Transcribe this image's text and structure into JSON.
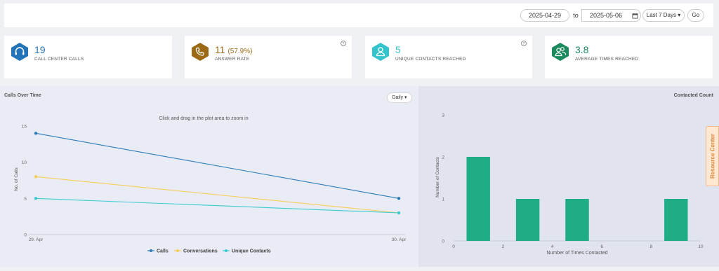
{
  "filters": {
    "date_from": "2025-04-29",
    "to_label": "to",
    "date_to": "2025-05-06",
    "calendar_icon": "calendar-icon",
    "range_label": "Last 7 Days ▾",
    "go_label": "Go"
  },
  "stats": [
    {
      "value": "19",
      "value_extra": "",
      "label": "CALL CENTER CALLS",
      "icon": "headset-icon",
      "color": "#2373b8",
      "value_color": "#2373b8"
    },
    {
      "value": "11",
      "value_extra": "(57.9%)",
      "label": "ANSWER RATE",
      "icon": "phone-icon",
      "color": "#9c6a14",
      "value_color": "#9c6a14"
    },
    {
      "value": "5",
      "value_extra": "",
      "label": "UNIQUE CONTACTS REACHED",
      "icon": "user-icon",
      "color": "#36c4cc",
      "value_color": "#36c4cc"
    },
    {
      "value": "3.8",
      "value_extra": "",
      "label": "AVERAGE TIMES REACHED",
      "icon": "users-icon",
      "color": "#1b8a5e",
      "value_color": "#1b8a5e"
    }
  ],
  "calls_panel": {
    "title": "Calls Over Time",
    "granularity": "Daily ▾"
  },
  "contacted_panel": {
    "title": "Contacted Count"
  },
  "resource_center": "Resource Center",
  "chart_data": [
    {
      "type": "line",
      "subtitle": "Click and drag in the plot area to zoom in",
      "ylabel": "No. of Calls",
      "xlabel": "",
      "categories": [
        "29. Apr",
        "30. Apr"
      ],
      "ylim": [
        0,
        15
      ],
      "yticks": [
        0,
        5,
        10,
        15
      ],
      "grid": false,
      "legend_position": "bottom-center",
      "series": [
        {
          "name": "Calls",
          "values": [
            14,
            5
          ],
          "color": "#2b7bb9"
        },
        {
          "name": "Conversations",
          "values": [
            8,
            3
          ],
          "color": "#f5cd57"
        },
        {
          "name": "Unique Contacts",
          "values": [
            5,
            3
          ],
          "color": "#3ccbd0"
        }
      ]
    },
    {
      "type": "bar",
      "title": "Contacted Count",
      "xlabel": "Number of Times Contacted",
      "ylabel": "Number of Contacts",
      "xlim": [
        0,
        10
      ],
      "xticks": [
        0,
        2,
        4,
        6,
        8,
        10
      ],
      "ylim": [
        0,
        3
      ],
      "yticks": [
        0,
        1,
        2,
        3
      ],
      "bar_color": "#1fad85",
      "bins": [
        {
          "x": 1,
          "value": 2
        },
        {
          "x": 3,
          "value": 1
        },
        {
          "x": 5,
          "value": 1
        },
        {
          "x": 9,
          "value": 1
        }
      ]
    }
  ]
}
